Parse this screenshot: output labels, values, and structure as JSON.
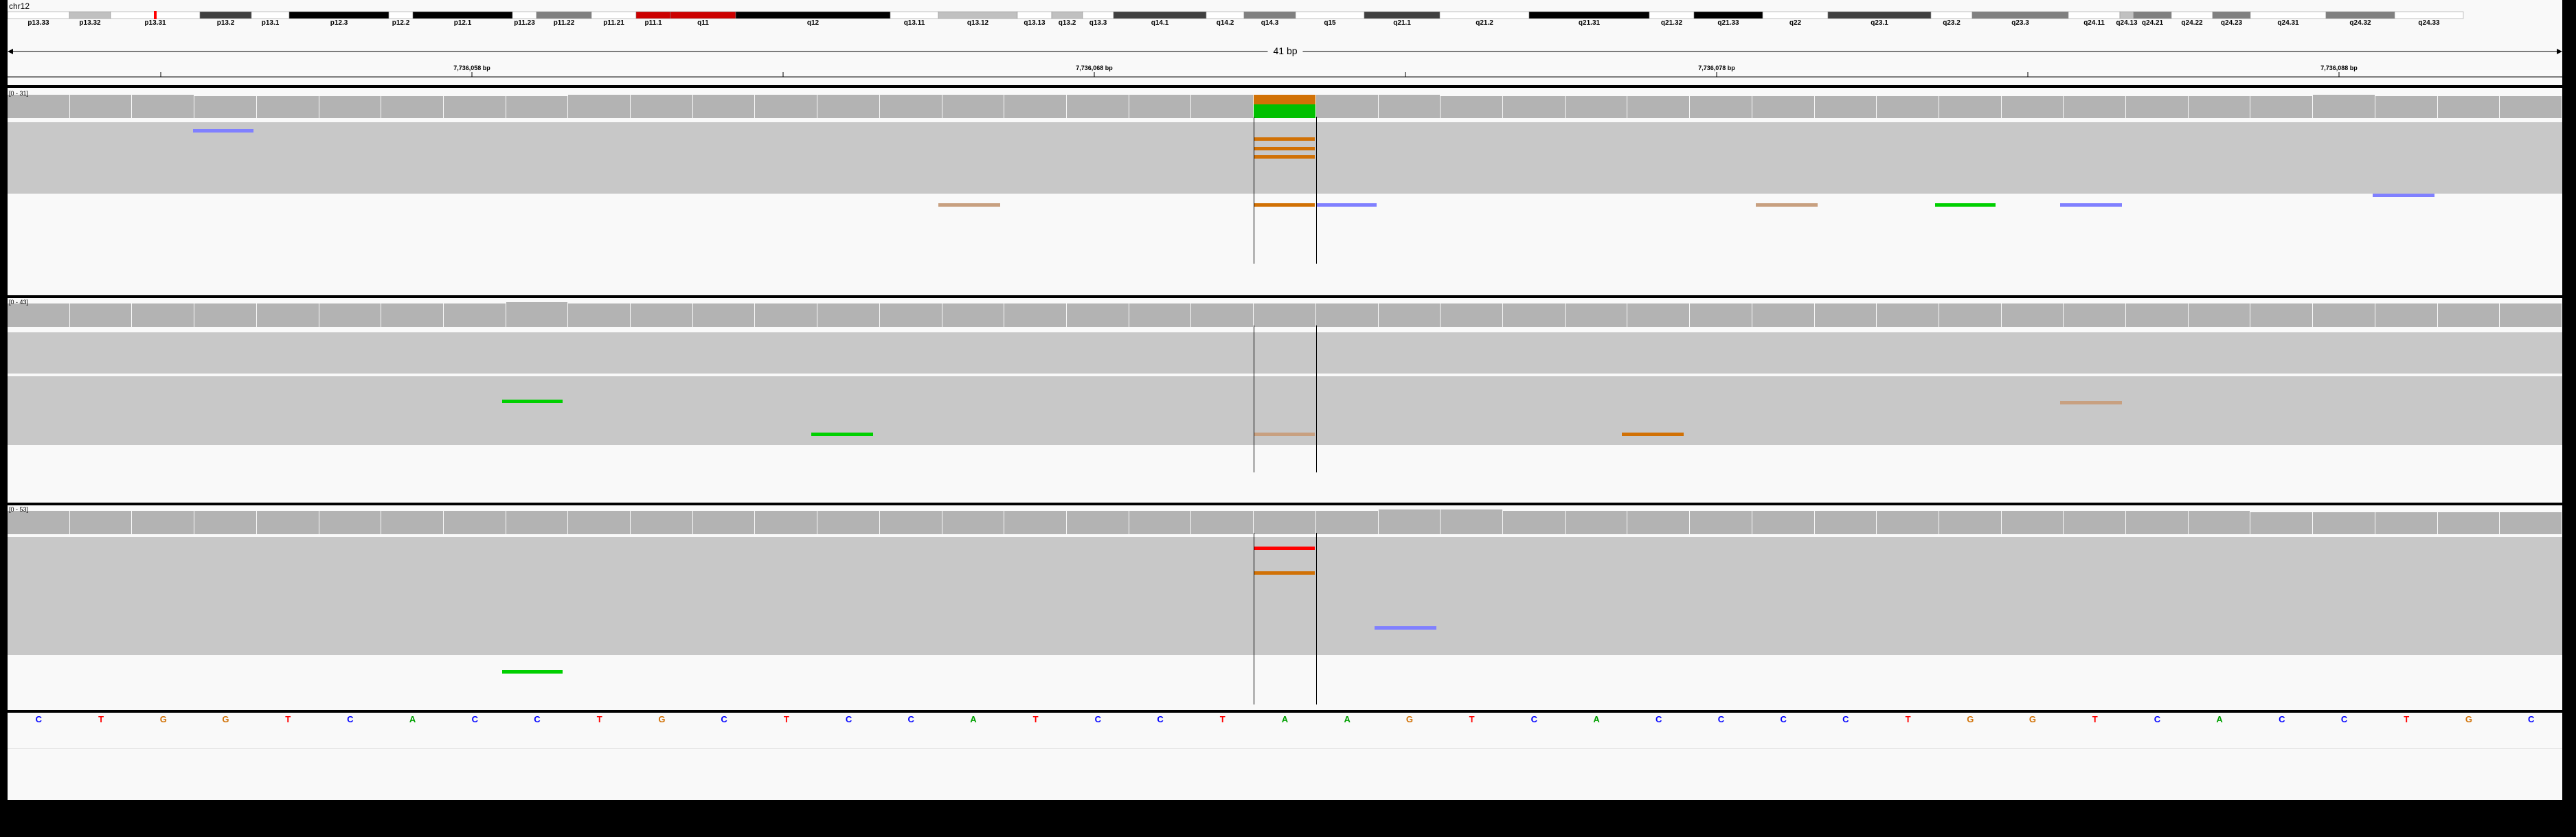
{
  "chromosome": "chr12",
  "ruler": {
    "span_label": "41 bp",
    "tick_labels": [
      "7,736,058 bp",
      "7,736,068 bp",
      "7,736,078 bp",
      "7,736,088 bp"
    ]
  },
  "cytobands": [
    "p13.33",
    "p13.32",
    "p13.31",
    "p13.2",
    "p13.1",
    "p12.3",
    "p12.2",
    "p12.1",
    "p11.23",
    "p11.22",
    "p11.21",
    "p11.1",
    "q11",
    "q12",
    "q13.11",
    "q13.12",
    "q13.13",
    "q13.2",
    "q13.3",
    "q14.1",
    "q14.2",
    "q14.3",
    "q15",
    "q21.1",
    "q21.2",
    "q21.31",
    "q21.32",
    "q21.33",
    "q22",
    "q23.1",
    "q23.2",
    "q23.3",
    "q24.11",
    "q24.13",
    "q24.21",
    "q24.22",
    "q24.23",
    "q24.31",
    "q24.32",
    "q24.33"
  ],
  "tracks": [
    {
      "range_label": "[0 - 31]"
    },
    {
      "range_label": "[0 - 43]"
    },
    {
      "range_label": "[0 - 53]"
    }
  ],
  "sequence": [
    "C",
    "T",
    "G",
    "G",
    "T",
    "C",
    "A",
    "C",
    "C",
    "T",
    "G",
    "C",
    "T",
    "C",
    "C",
    "A",
    "T",
    "C",
    "C",
    "T",
    "A",
    "A",
    "G",
    "T",
    "C",
    "A",
    "C",
    "C",
    "C",
    "C",
    "T",
    "G",
    "G",
    "T",
    "C",
    "A",
    "C",
    "C",
    "T",
    "G",
    "C"
  ],
  "colors": {
    "A": "#00a000",
    "C": "#0000ff",
    "G": "#d17105",
    "T": "#ff0000",
    "read": "#c8c8c8",
    "coverage": "#b3b3b3"
  }
}
